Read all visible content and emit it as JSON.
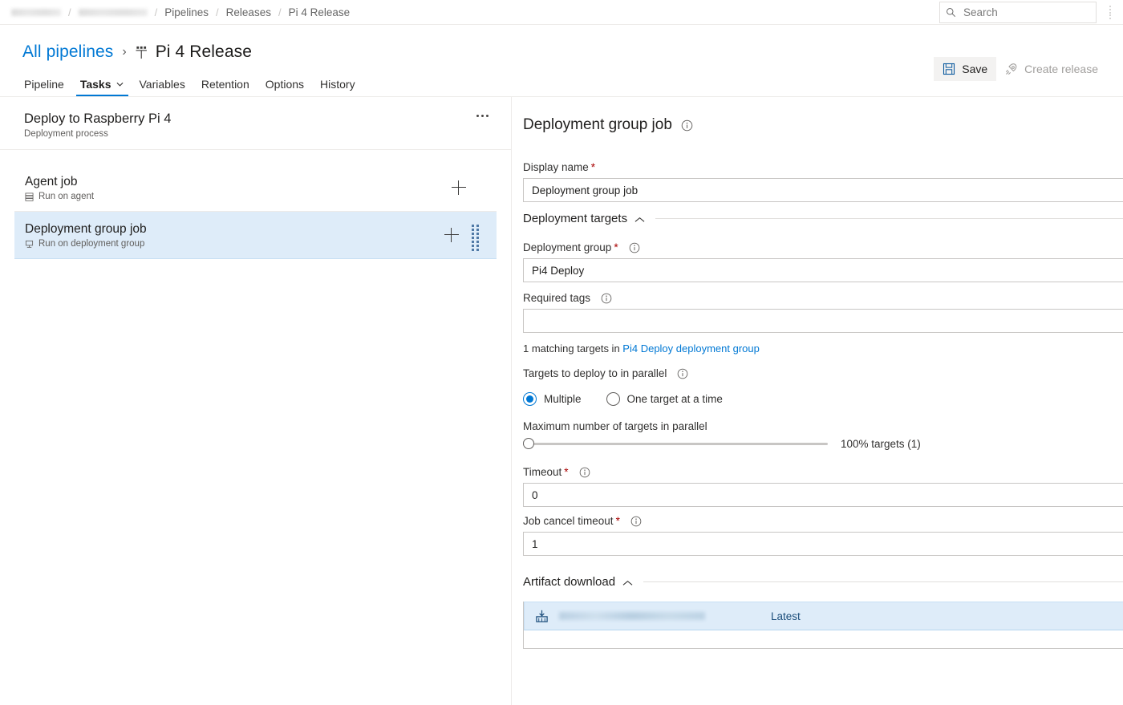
{
  "topbar": {
    "breadcrumbs": [
      {
        "label": "",
        "redacted": true
      },
      {
        "label": "",
        "redacted": true
      },
      {
        "label": "Pipelines",
        "redacted": false
      },
      {
        "label": "Releases",
        "redacted": false
      },
      {
        "label": "Pi 4 Release",
        "redacted": false
      }
    ],
    "separator": "/",
    "search": {
      "placeholder": "Search",
      "value": "",
      "icon": "search-icon"
    },
    "more_icon": "vertical-ellipsis-icon"
  },
  "header": {
    "all_pipelines": "All pipelines",
    "chevron": "›",
    "title": "Pi 4 Release",
    "title_icon": "release-pipeline-icon",
    "actions": {
      "save_label": "Save",
      "save_icon": "save-floppy-icon",
      "create_release_label": "Create release",
      "create_release_icon": "rocket-icon"
    }
  },
  "tabs": {
    "items": [
      {
        "label": "Pipeline",
        "active": false,
        "chevron": false
      },
      {
        "label": "Tasks",
        "active": true,
        "chevron": true
      },
      {
        "label": "Variables",
        "active": false,
        "chevron": false
      },
      {
        "label": "Retention",
        "active": false,
        "chevron": false
      },
      {
        "label": "Options",
        "active": false,
        "chevron": false
      },
      {
        "label": "History",
        "active": false,
        "chevron": false
      }
    ],
    "chevron_glyph": "⌄"
  },
  "left_panel": {
    "process": {
      "name": "Deploy to Raspberry Pi 4",
      "subtitle": "Deployment process",
      "menu_icon": "ellipsis-icon"
    },
    "jobs": [
      {
        "name": "Agent job",
        "subtitle": "Run on agent",
        "icon": "agent-icon",
        "selected": false,
        "add_icon": "plus-icon",
        "has_grip": false
      },
      {
        "name": "Deployment group job",
        "subtitle": "Run on deployment group",
        "icon": "deployment-group-icon",
        "selected": true,
        "add_icon": "plus-icon",
        "has_grip": true
      }
    ]
  },
  "detail": {
    "title": "Deployment group job",
    "title_info_icon": "info-icon",
    "display_name": {
      "label": "Display name",
      "required": "*",
      "value": "Deployment group job"
    },
    "deployment_targets": {
      "section_label": "Deployment targets",
      "collapse_icon": "chevron-up-icon",
      "deployment_group": {
        "label": "Deployment group",
        "required": "*",
        "info_icon": "info-icon",
        "value": "Pi4 Deploy"
      },
      "required_tags": {
        "label": "Required tags",
        "info_icon": "info-icon",
        "value": "",
        "placeholder": ""
      },
      "matching_text_prefix": "1 matching targets in ",
      "matching_link": "Pi4 Deploy deployment group",
      "parallel": {
        "label": "Targets to deploy to in parallel",
        "info_icon": "info-icon",
        "options": [
          {
            "label": "Multiple",
            "selected": true
          },
          {
            "label": "One target at a time",
            "selected": false
          }
        ]
      },
      "max_parallel": {
        "label": "Maximum number of targets in parallel",
        "value_text": "100% targets (1)",
        "slider_percent": 0
      },
      "timeout": {
        "label": "Timeout",
        "required": "*",
        "info_icon": "info-icon",
        "value": "0"
      },
      "job_cancel_timeout": {
        "label": "Job cancel timeout",
        "required": "*",
        "info_icon": "info-icon",
        "value": "1"
      }
    },
    "artifact_download": {
      "section_label": "Artifact download",
      "collapse_icon": "chevron-up-icon",
      "artifact": {
        "name": "",
        "name_redacted": true,
        "version": "Latest",
        "icon": "artifact-download-icon",
        "collapse_icon": "chevron-up-icon"
      }
    }
  },
  "colors": {
    "accent": "#0078d4",
    "selection": "#deecf9",
    "required": "#a80000",
    "border": "#c8c6c4"
  }
}
